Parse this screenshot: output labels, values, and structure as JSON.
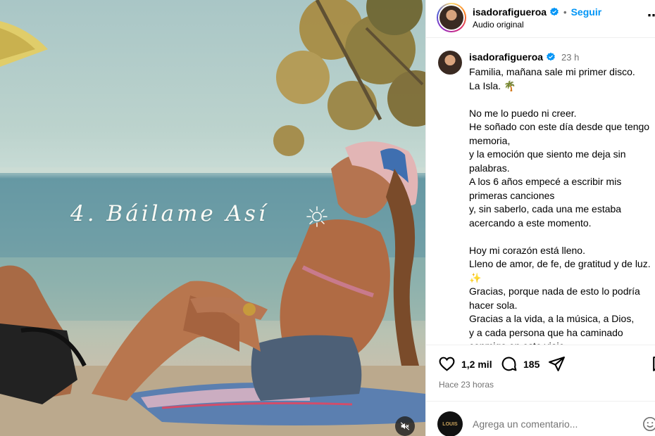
{
  "media": {
    "overlay_text": "4. Báilame Así"
  },
  "header": {
    "username": "isadorafigueroa",
    "separator": "•",
    "follow_label": "Seguir",
    "audio_label": "Audio original",
    "more_label": "⋯"
  },
  "caption": {
    "username": "isadorafigueroa",
    "time": "23 h",
    "text": "Familia, mañana sale mi primer disco.\nLa Isla. 🌴\n\nNo me lo puedo ni creer.\nHe soñado con este día desde que tengo memoria,\ny la emoción que siento me deja sin palabras.\nA los 6 años empecé a escribir mis primeras canciones\ny, sin saberlo, cada una me estaba acercando a este momento.\n\nHoy mi corazón está lleno.\nLleno de amor, de fe, de gratitud y de luz. ✨\nGracias, porque nada de esto lo podría hacer sola.\nGracias a la vida, a la música, a Dios,\ny a cada persona que ha caminado conmigo en este viaje."
  },
  "actions": {
    "likes": "1,2 mil",
    "comments": "185",
    "posted_ago": "Hace 23 horas"
  },
  "comment_box": {
    "placeholder": "Agrega un comentario...",
    "avatar_text": "LOUIS"
  },
  "colors": {
    "accent": "#0095f6",
    "secondary_text": "#737373",
    "border": "#efefef"
  }
}
